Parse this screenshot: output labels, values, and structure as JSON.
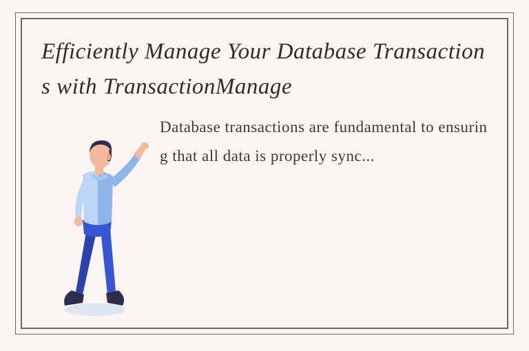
{
  "card": {
    "title": "Efficiently Manage Your Database Transactions with TransactionManage",
    "body": "Database transactions are fundamental to ensuring that all data is properly sync..."
  },
  "illustration": {
    "name": "person-pointing-figure",
    "palette": {
      "skin": "#f2b99a",
      "shirt_light": "#bcd6f7",
      "shirt_dark": "#8fb4e8",
      "pants": "#3656d6",
      "pants_dark": "#2a43aa",
      "hair": "#2e2c4f",
      "shoe": "#2e2c4f"
    }
  },
  "colors": {
    "page_bg": "#fbf4f2",
    "frame": "#6b6460",
    "text": "#2d2d2d"
  }
}
